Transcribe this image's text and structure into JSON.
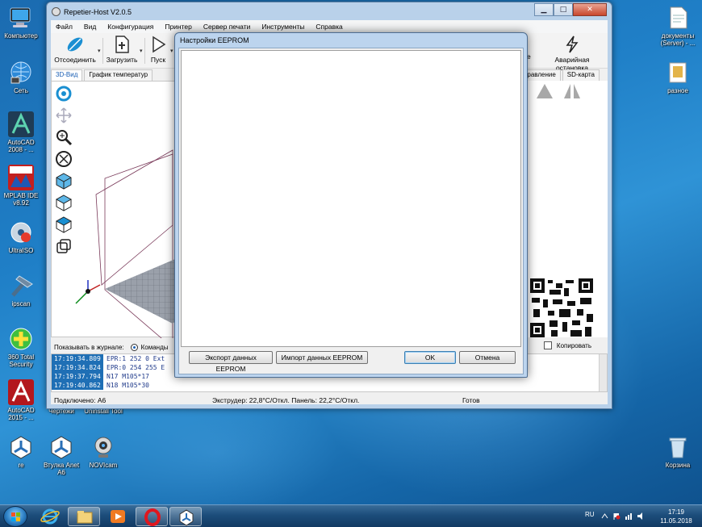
{
  "desktop": {
    "left_icons": [
      {
        "label": "Компьютер",
        "icon": "computer-icon"
      },
      {
        "label": "Сеть",
        "icon": "network-icon"
      },
      {
        "label": "AutoCAD 2008 - ...",
        "icon": "autocad-icon"
      },
      {
        "label": "MPLAB IDE v8.92",
        "icon": "mplab-icon"
      },
      {
        "label": "UltraISO",
        "icon": "ultraiso-icon"
      },
      {
        "label": "ipscan",
        "icon": "ipscan-icon"
      },
      {
        "label": "360 Total Security",
        "icon": "security-icon"
      },
      {
        "label": "AutoCAD 2015 - ...",
        "icon": "autocad2015-icon"
      },
      {
        "label": "re",
        "icon": "repetier-icon"
      },
      {
        "label": "Втулка Anet A6",
        "icon": "repetier-file-icon"
      },
      {
        "label": "NOVIcam",
        "icon": "webcam-icon"
      }
    ],
    "bottom_row_labels": [
      "Чертежи",
      "Uninstall Tool"
    ],
    "right_icons": [
      {
        "label": "документы (Server) - ...",
        "icon": "document-icon"
      },
      {
        "label": "разное",
        "icon": "folder-icon"
      },
      {
        "label": "Корзина",
        "icon": "recycle-bin-icon"
      }
    ]
  },
  "app_window": {
    "title": "Repetier-Host V2.0.5",
    "menu": [
      "Файл",
      "Вид",
      "Конфигурация",
      "Принтер",
      "Сервер печати",
      "Инструменты",
      "Справка"
    ],
    "toolbar": {
      "disconnect_label": "Отсоединить",
      "load_label": "Загрузить",
      "run_label": "Пуск",
      "hidden_label_fragment": "de",
      "emergency_label": "Аварийная остановка"
    },
    "tabs": [
      "3D-Вид",
      "График температур"
    ],
    "right_tabs": [
      "Управление",
      "SD-карта"
    ],
    "log_filter_label": "Показывать в журнале:",
    "log_filter_option": "Команды",
    "copy_label": "Копировать",
    "log": [
      {
        "time": "17:19:34.809",
        "text": "EPR:1 252 0 Ext"
      },
      {
        "time": "17:19:34.824",
        "text": "EPR:0 254 255 E"
      },
      {
        "time": "17:19:37.794",
        "text": "N17 M105*17"
      },
      {
        "time": "17:19:40.862",
        "text": "N18 M105*30"
      }
    ],
    "status": {
      "connection": "Подключено: A6",
      "temps": "Экструдер: 22,8°C/Откл. Панель: 22,2°C/Откл.",
      "state": "Готов"
    }
  },
  "dialog": {
    "title": "Настройки EEPROM",
    "export_label": "Экспорт данных EEPROM",
    "import_label": "Импорт данных EEPROM",
    "ok_label": "OK",
    "cancel_label": "Отмена"
  },
  "taskbar": {
    "language": "RU",
    "time": "17:19",
    "date": "11.05.2018"
  },
  "colors": {
    "accent": "#1a5fb4",
    "log_time_bg": "#1f6fb5",
    "emergency": "#222222"
  }
}
